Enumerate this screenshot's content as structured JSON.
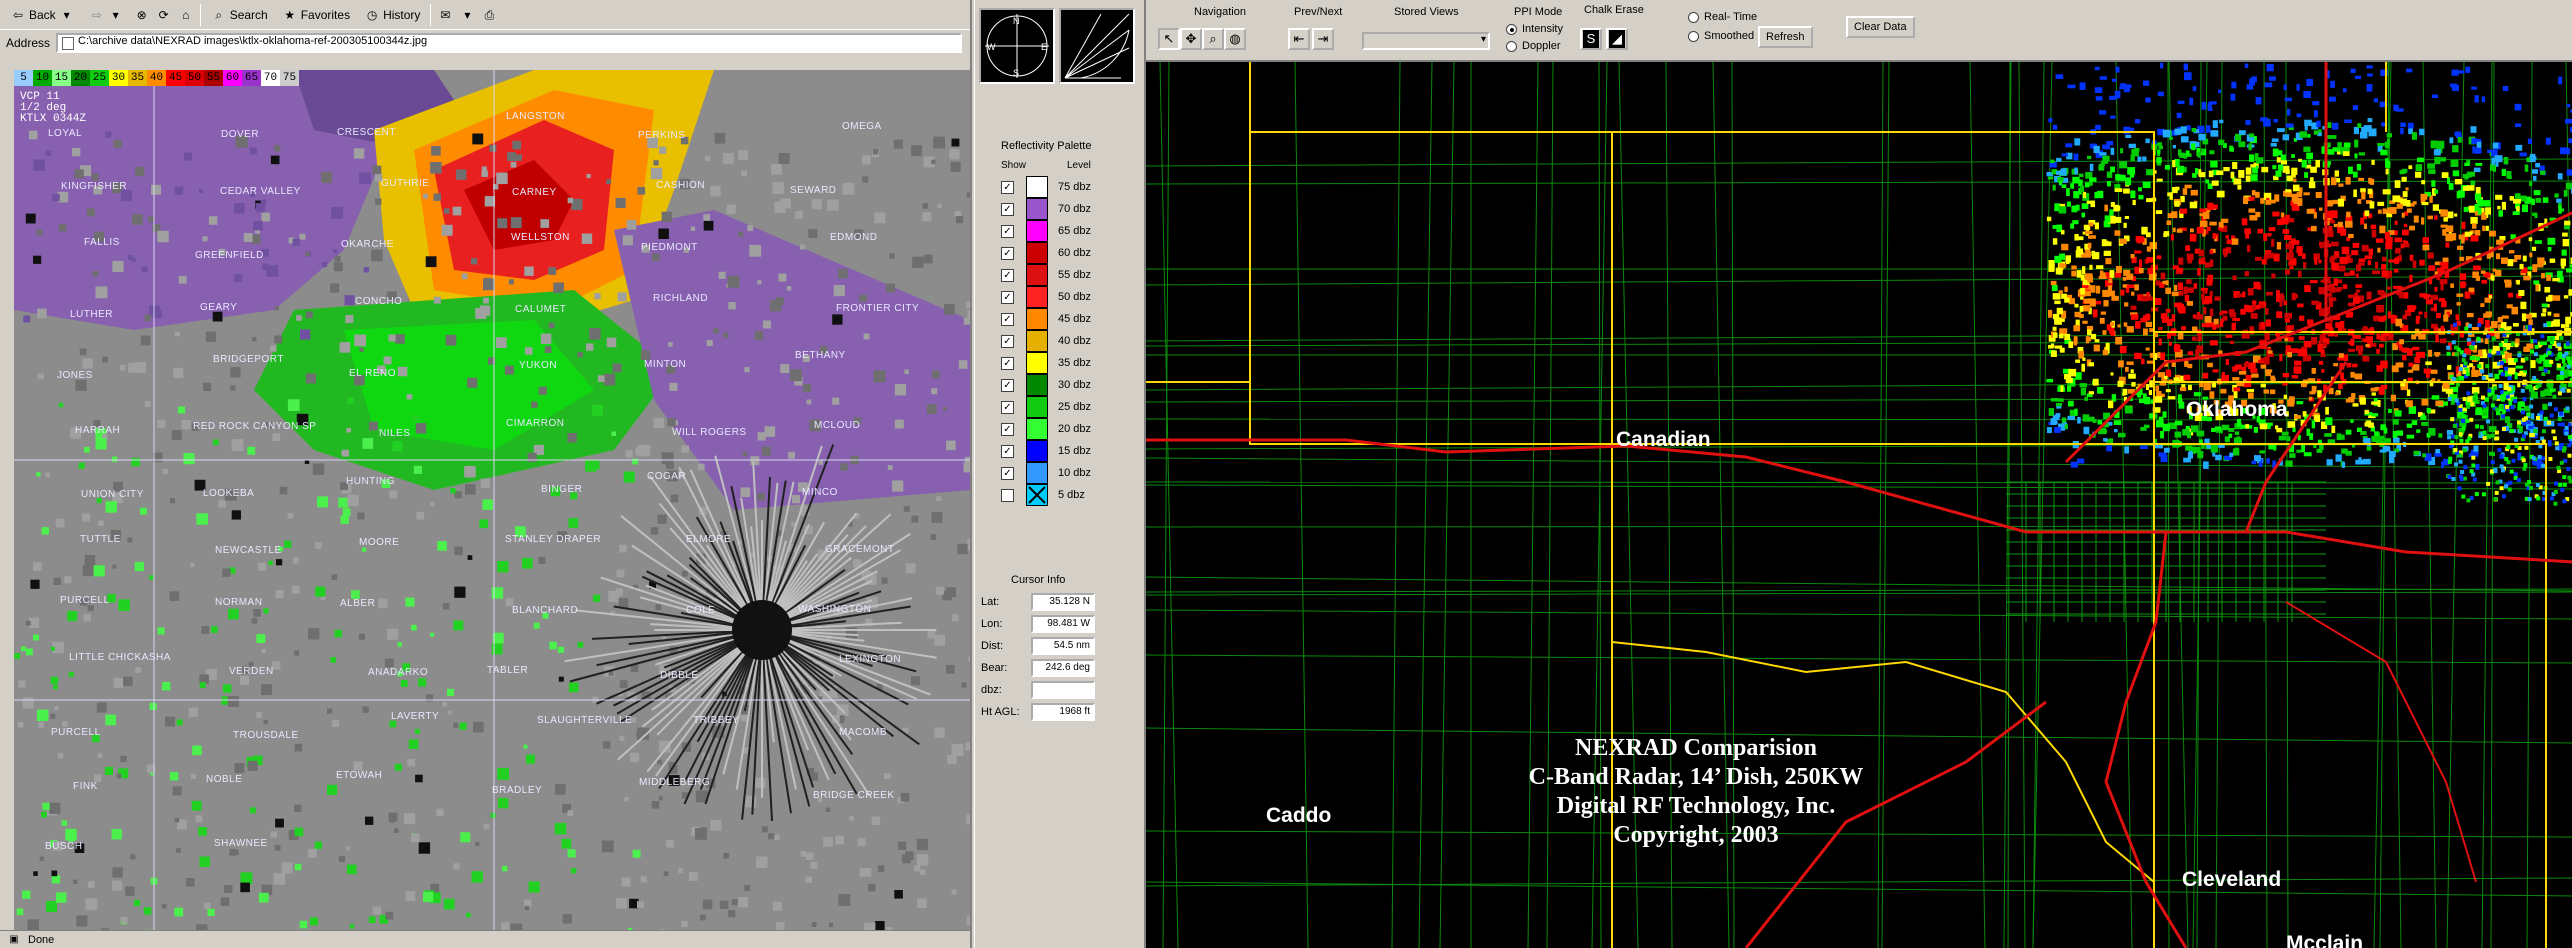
{
  "browser": {
    "toolbar": {
      "back_label": "Back",
      "search_label": "Search",
      "favorites_label": "Favorites",
      "history_label": "History"
    },
    "address": {
      "label": "Address",
      "value": "C:\\archive data\\NEXRAD images\\ktlx-oklahoma-ref-200305100344z.jpg"
    },
    "status": "Done",
    "radar_image": {
      "legend_levels": [
        "5",
        "10",
        "15",
        "20",
        "25",
        "30",
        "35",
        "40",
        "45",
        "50",
        "55",
        "60",
        "65",
        "70",
        "75"
      ],
      "legend_colors": [
        "#9cf",
        "#0a0",
        "#8f8",
        "#080",
        "#1c1",
        "#ff0",
        "#e6b800",
        "#ff8c00",
        "#f00",
        "#d00",
        "#a00",
        "#f0f",
        "#93c",
        "#fff",
        "#ccc"
      ],
      "vcp_text": "VCP 11\n1/2 deg\nKTLX 0344Z",
      "towns": [
        "LOYAL",
        "DOVER",
        "CRESCENT",
        "LANGSTON",
        "PERKINS",
        "OMEGA",
        "KINGFISHER",
        "CEDAR VALLEY",
        "GUTHRIE",
        "CARNEY",
        "CASHION",
        "SEWARD",
        "FALLIS",
        "GREENFIELD",
        "OKARCHE",
        "WELLSTON",
        "PIEDMONT",
        "EDMOND",
        "LUTHER",
        "GEARY",
        "CONCHO",
        "CALUMET",
        "RICHLAND",
        "FRONTIER CITY",
        "JONES",
        "BRIDGEPORT",
        "EL RENO",
        "YUKON",
        "MINTON",
        "BETHANY",
        "HARRAH",
        "RED ROCK CANYON SP",
        "NILES",
        "CIMARRON",
        "WILL ROGERS",
        "MCLOUD",
        "UNION CITY",
        "LOOKEBA",
        "HUNTING",
        "BINGER",
        "COGAR",
        "MINCO",
        "TUTTLE",
        "NEWCASTLE",
        "MOORE",
        "STANLEY DRAPER",
        "ELMORE",
        "GRACEMONT",
        "PURCELL",
        "NORMAN",
        "ALBER",
        "BLANCHARD",
        "COLE",
        "WASHINGTON",
        "LITTLE CHICKASHA",
        "VERDEN",
        "ANADARKO",
        "TABLER",
        "DIBBLE",
        "LEXINGTON",
        "PURCELL",
        "TROUSDALE",
        "LAVERTY",
        "SLAUGHTERVILLE",
        "TRIBBEY",
        "MACOMB",
        "FINK",
        "NOBLE",
        "ETOWAH",
        "BRADLEY",
        "MIDDLEBERG",
        "BRIDGE CREEK",
        "BUSCH",
        "SHAWNEE"
      ]
    }
  },
  "controls": {
    "palette": {
      "title": "Reflectivity Palette",
      "show_header": "Show",
      "level_header": "Level",
      "rows": [
        {
          "label": "75 dbz",
          "color": "#ffffff",
          "checked": true
        },
        {
          "label": "70 dbz",
          "color": "#9955cc",
          "checked": true
        },
        {
          "label": "65 dbz",
          "color": "#ff00ff",
          "checked": true
        },
        {
          "label": "60 dbz",
          "color": "#cc0000",
          "checked": true
        },
        {
          "label": "55 dbz",
          "color": "#dd1111",
          "checked": true
        },
        {
          "label": "50 dbz",
          "color": "#ff2222",
          "checked": true
        },
        {
          "label": "45 dbz",
          "color": "#ff8800",
          "checked": true
        },
        {
          "label": "40 dbz",
          "color": "#e6b000",
          "checked": true
        },
        {
          "label": "35 dbz",
          "color": "#ffff00",
          "checked": true
        },
        {
          "label": "30 dbz",
          "color": "#008800",
          "checked": true
        },
        {
          "label": "25 dbz",
          "color": "#11cc11",
          "checked": true
        },
        {
          "label": "20 dbz",
          "color": "#33ff33",
          "checked": true
        },
        {
          "label": "15 dbz",
          "color": "#0000ff",
          "checked": true
        },
        {
          "label": "10 dbz",
          "color": "#3399ff",
          "checked": true
        },
        {
          "label": "5 dbz",
          "color": "#00ccff",
          "checked": false
        }
      ]
    },
    "cursor_info": {
      "title": "Cursor Info",
      "rows": [
        {
          "label": "Lat:",
          "value": "35.128 N"
        },
        {
          "label": "Lon:",
          "value": "98.481 W"
        },
        {
          "label": "Dist:",
          "value": "54.5 nm"
        },
        {
          "label": "Bear:",
          "value": "242.6 deg"
        },
        {
          "label": "dbz:",
          "value": ""
        },
        {
          "label": "Ht AGL:",
          "value": "1968 ft"
        }
      ]
    }
  },
  "app": {
    "navigation_label": "Navigation",
    "prevnext_label": "Prev/Next",
    "stored_views_label": "Stored Views",
    "ppi_mode_label": "PPI Mode",
    "intensity_label": "Intensity",
    "doppler_label": "Doppler",
    "chalk_erase_label": "Chalk Erase",
    "realtime_label": "Real- Time",
    "smoothed_label": "Smoothed",
    "refresh_label": "Refresh",
    "clear_label": "Clear Data",
    "map": {
      "counties": {
        "canadian": "Canadian",
        "oklahoma": "Oklahoma",
        "caddo": "Caddo",
        "cleveland": "Cleveland",
        "mcclain": "Mcclain"
      },
      "caption": [
        "NEXRAD Comparision",
        "C-Band Radar, 14’ Dish, 250KW",
        "Digital RF Technology, Inc.",
        "Copyright, 2003"
      ]
    }
  }
}
